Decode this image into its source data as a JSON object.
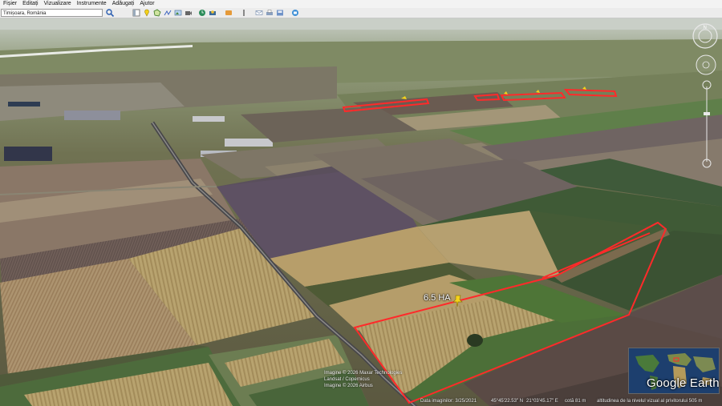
{
  "menu": [
    "Fișier",
    "Editați",
    "Vizualizare",
    "Instrumente",
    "Adăugați",
    "Ajutor"
  ],
  "search": {
    "value": "Timișoara, România"
  },
  "toolbar_icons": [
    "sidebar-icon",
    "placemark-icon",
    "polygon-icon",
    "path-icon",
    "image-overlay-icon",
    "record-tour-icon",
    "historical-imagery-icon",
    "sunlight-icon",
    "planets-icon",
    "ruler-icon",
    "email-icon",
    "print-icon",
    "save-image-icon",
    "view-in-maps-icon"
  ],
  "placemark": {
    "label": "6.5 HA"
  },
  "attribution": {
    "line1": "Imagine © 2026 Maxar Technologies",
    "line2": "Landsat / Copernicus",
    "line3": "Imagine © 2026 Airbus"
  },
  "status": {
    "imagery_date": "Data imaginilor: 3/25/2021",
    "lat": "45°45'22.53\" N",
    "lon": "21°03'45.17\" E",
    "elevation": "cotă   81 m",
    "eye_alt": "altitudinea de la nivelul vizual al privitorului  505 m"
  },
  "logo": "Google Earth",
  "colors": {
    "boundary": "#ff2a2a",
    "placemark": "#f5d21a"
  }
}
